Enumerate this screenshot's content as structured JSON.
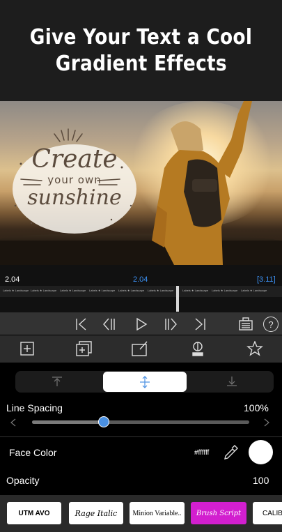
{
  "banner": {
    "line1": "Give Your Text a Cool",
    "line2": "Gradient Effects"
  },
  "artwork": {
    "word1": "Create",
    "word2": "your own",
    "word3": "sunshine"
  },
  "timeline": {
    "current_time": "2.04",
    "playhead_time": "2.04",
    "total_time": "[3.11]",
    "strip_label": "Labels ★ Landscape"
  },
  "controls": {
    "icons": [
      "skip-to-start-icon",
      "step-back-icon",
      "play-icon",
      "step-forward-icon",
      "skip-to-end-icon",
      "layers-icon",
      "help-icon"
    ],
    "help_glyph": "?"
  },
  "toolbar": {
    "icons": [
      "add-text-icon",
      "add-layer-icon",
      "edit-icon",
      "paint-icon",
      "favorites-icon"
    ]
  },
  "panel": {
    "line_spacing_label": "Line Spacing",
    "line_spacing_value": "100%",
    "line_spacing_fraction": 0.33,
    "face_color_label": "Face Color",
    "face_color_hex": "#ffffff",
    "opacity_label": "Opacity",
    "opacity_value": "100",
    "align_options": [
      "align-top-icon",
      "align-center-icon",
      "align-bottom-icon"
    ],
    "selected_align": "align-center-icon"
  },
  "fonts": {
    "items": [
      {
        "label": "UTM AVO",
        "selected": false
      },
      {
        "label": "Rage Italic",
        "selected": false
      },
      {
        "label": "Minion Variable..",
        "selected": false
      },
      {
        "label": "Brush Script",
        "selected": true
      },
      {
        "label": "CALIB",
        "selected": false
      }
    ],
    "accent": "#d21fcf"
  },
  "colors": {
    "accent_blue": "#4a90e2",
    "timecode_blue": "#3b8ff0"
  }
}
